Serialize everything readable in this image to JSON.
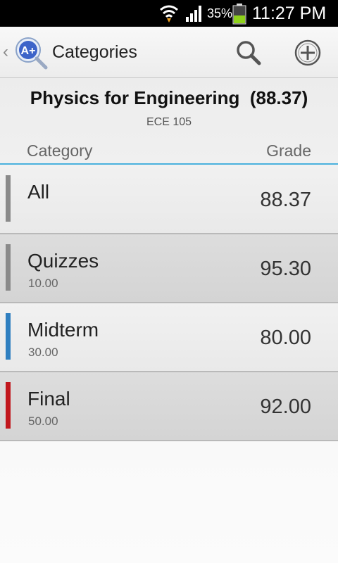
{
  "status_bar": {
    "battery_percent": "35%",
    "time": "11:27 PM"
  },
  "action_bar": {
    "title": "Categories",
    "icons": [
      "back-chevron-icon",
      "app-grade-icon",
      "search-icon",
      "add-circle-icon"
    ]
  },
  "course": {
    "title": "Physics for Engineering  (88.37)",
    "code": "ECE 105"
  },
  "columns": {
    "category": "Category",
    "grade": "Grade"
  },
  "categories": [
    {
      "name": "All",
      "weight": "",
      "grade": "88.37",
      "color": "#8a8a8a"
    },
    {
      "name": "Quizzes",
      "weight": "10.00",
      "grade": "95.30",
      "color": "#8a8a8a"
    },
    {
      "name": "Midterm",
      "weight": "30.00",
      "grade": "80.00",
      "color": "#2f7fc0"
    },
    {
      "name": "Final",
      "weight": "50.00",
      "grade": "92.00",
      "color": "#c1171d"
    }
  ],
  "colors": {
    "accent": "#4ab1de",
    "status_bar": "#000000",
    "battery_fill": "#8ed11a"
  }
}
